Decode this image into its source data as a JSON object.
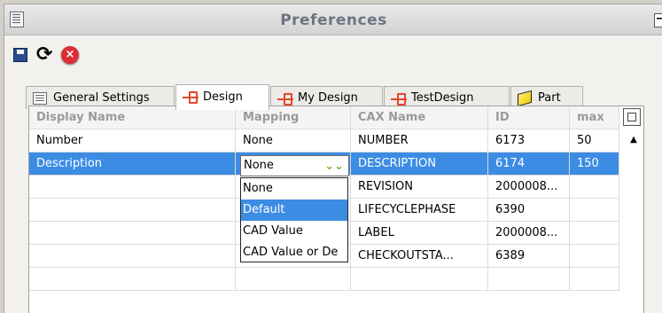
{
  "window": {
    "title": "Preferences",
    "collapse_icon": "minus-icon"
  },
  "toolbar": [
    {
      "name": "save",
      "icon": "save-icon"
    },
    {
      "name": "refresh",
      "icon": "refresh-icon"
    },
    {
      "name": "cancel",
      "icon": "cancel-icon"
    }
  ],
  "tabs": [
    {
      "label": "General Settings",
      "icon": "document-icon"
    },
    {
      "label": "Design",
      "icon": "design-icon",
      "active": true
    },
    {
      "label": "My Design",
      "icon": "design-icon"
    },
    {
      "label": "TestDesign",
      "icon": "design-icon"
    },
    {
      "label": "Part",
      "icon": "part-icon"
    }
  ],
  "table": {
    "columns": [
      "Display Name",
      "Mapping",
      "CAX Name",
      "ID",
      "max"
    ],
    "rows": [
      [
        "Number",
        "None",
        "NUMBER",
        "6173",
        "50"
      ],
      [
        "Description",
        "None",
        "DESCRIPTION",
        "6174",
        "150"
      ],
      [
        "",
        "",
        "REVISION",
        "2000008...",
        ""
      ],
      [
        "",
        "",
        "LIFECYCLEPHASE",
        "6390",
        ""
      ],
      [
        "",
        "",
        "LABEL",
        "2000008...",
        ""
      ],
      [
        "",
        "",
        "CHECKOUTSTA...",
        "6389",
        ""
      ]
    ],
    "selected_row": 1
  },
  "mapping_dropdown": {
    "value": "None",
    "options": [
      "None",
      "Default",
      "CAD Value",
      "CAD Value or De"
    ],
    "highlighted": "Default"
  },
  "colors": {
    "selection": "#3d8ce4",
    "accent_red": "#e4472c"
  }
}
